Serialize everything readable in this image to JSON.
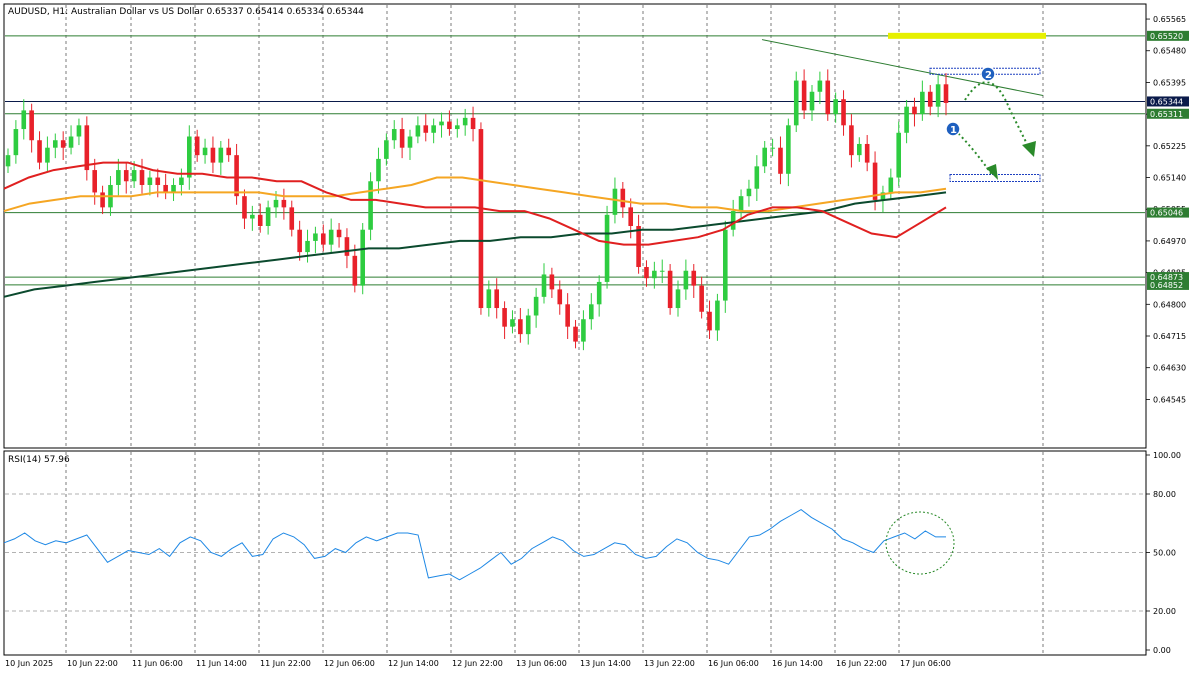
{
  "header": {
    "title": "AUDUSD, H1:  Australian Dollar vs US Dollar  0.65337 0.65414 0.65334 0.65344"
  },
  "rsi": {
    "label": "RSI(14) 57.96",
    "ticks": [
      "100.00",
      "80.00",
      "50.00",
      "20.00",
      "0.00"
    ]
  },
  "price_axis": {
    "ticks": [
      "0.65565",
      "0.65480",
      "0.65395",
      "0.65310",
      "0.65225",
      "0.65140",
      "0.65055",
      "0.64970",
      "0.64885",
      "0.64800",
      "0.64715",
      "0.64630",
      "0.64545"
    ]
  },
  "time_axis": {
    "labels": [
      "10 Jun 2025",
      "10 Jun 22:00",
      "11 Jun 06:00",
      "11 Jun 14:00",
      "11 Jun 22:00",
      "12 Jun 06:00",
      "12 Jun 14:00",
      "12 Jun 22:00",
      "13 Jun 06:00",
      "13 Jun 14:00",
      "13 Jun 22:00",
      "16 Jun 06:00",
      "16 Jun 14:00",
      "16 Jun 22:00",
      "17 Jun 06:00"
    ]
  },
  "price_labels": [
    {
      "text": "0.65520",
      "price": 0.6552,
      "bg": "#2e7d32",
      "fg": "#ffffff"
    },
    {
      "text": "0.65344",
      "price": 0.65344,
      "bg": "#0a1a4a",
      "fg": "#ffffff"
    },
    {
      "text": "0.65311",
      "price": 0.65311,
      "bg": "#2e7d32",
      "fg": "#ffffff"
    },
    {
      "text": "0.65046",
      "price": 0.65046,
      "bg": "#2e7d32",
      "fg": "#ffffff"
    },
    {
      "text": "0.64873",
      "price": 0.64873,
      "bg": "#2e7d32",
      "fg": "#ffffff"
    },
    {
      "text": "0.64852",
      "price": 0.64852,
      "bg": "#2e7d32",
      "fg": "#ffffff"
    }
  ],
  "annotations": {
    "marker1": "1",
    "marker2": "2"
  },
  "colors": {
    "bull": "#2ecc40",
    "bear": "#e8212a",
    "ma_red": "#e02020",
    "ma_orange": "#f5a623",
    "ma_dark": "#0b4a2e",
    "rsi_line": "#1e88e5",
    "hline": "#2e7d32",
    "highlight": "#e6f000"
  },
  "chart_data": {
    "type": "candlestick",
    "symbol": "AUDUSD",
    "timeframe": "H1",
    "ohlc_last": {
      "open": 0.65337,
      "high": 0.65414,
      "low": 0.65334,
      "close": 0.65344
    },
    "ylim": [
      0.6442,
      0.656
    ],
    "closes": [
      0.652,
      0.6527,
      0.6532,
      0.6524,
      0.6518,
      0.6522,
      0.6524,
      0.6522,
      0.6525,
      0.6528,
      0.6516,
      0.651,
      0.6506,
      0.6512,
      0.6516,
      0.6513,
      0.6516,
      0.6512,
      0.6514,
      0.6512,
      0.651,
      0.6512,
      0.6514,
      0.6525,
      0.652,
      0.6522,
      0.6518,
      0.6522,
      0.652,
      0.6509,
      0.6503,
      0.6504,
      0.6501,
      0.6506,
      0.6508,
      0.6506,
      0.65,
      0.6494,
      0.6497,
      0.6499,
      0.6496,
      0.65,
      0.6498,
      0.6493,
      0.6485,
      0.65,
      0.6513,
      0.6519,
      0.6524,
      0.6527,
      0.6522,
      0.6525,
      0.6528,
      0.6526,
      0.6528,
      0.6529,
      0.6527,
      0.6528,
      0.653,
      0.6527,
      0.6479,
      0.6484,
      0.6479,
      0.6474,
      0.6476,
      0.6472,
      0.6477,
      0.6482,
      0.6488,
      0.6484,
      0.648,
      0.6474,
      0.647,
      0.6476,
      0.648,
      0.6486,
      0.6504,
      0.6511,
      0.6506,
      0.6501,
      0.649,
      0.6487,
      0.6489,
      0.6489,
      0.6479,
      0.6484,
      0.6489,
      0.6485,
      0.6478,
      0.6473,
      0.6481,
      0.65,
      0.6505,
      0.6509,
      0.6511,
      0.6517,
      0.6522,
      0.6522,
      0.6515,
      0.6528,
      0.654,
      0.6532,
      0.6537,
      0.654,
      0.6531,
      0.6535,
      0.6528,
      0.652,
      0.6523,
      0.6518,
      0.6508,
      0.651,
      0.6514,
      0.6526,
      0.6533,
      0.6531,
      0.6537,
      0.6533,
      0.6539,
      0.6534
    ],
    "ma_red": [
      0.6511,
      0.6514,
      0.6516,
      0.6517,
      0.6518,
      0.6518,
      0.6516,
      0.6515,
      0.6515,
      0.6514,
      0.6514,
      0.6513,
      0.6513,
      0.651,
      0.6508,
      0.6508,
      0.6507,
      0.6506,
      0.6506,
      0.6506,
      0.6505,
      0.6505,
      0.6503,
      0.65,
      0.6497,
      0.6496,
      0.6496,
      0.6497,
      0.6498,
      0.65,
      0.6504,
      0.6506,
      0.6506,
      0.6505,
      0.6502,
      0.6499,
      0.6498,
      0.6502,
      0.6506
    ],
    "ma_orange": [
      0.6505,
      0.6507,
      0.6508,
      0.6509,
      0.6509,
      0.6509,
      0.651,
      0.651,
      0.651,
      0.651,
      0.651,
      0.6509,
      0.6509,
      0.6509,
      0.651,
      0.6511,
      0.6512,
      0.6514,
      0.6514,
      0.6513,
      0.6512,
      0.6511,
      0.651,
      0.6509,
      0.6508,
      0.6507,
      0.6507,
      0.6506,
      0.6506,
      0.6505,
      0.6505,
      0.6506,
      0.6507,
      0.6508,
      0.6509,
      0.651,
      0.651,
      0.6511
    ],
    "ma_dark": [
      0.6482,
      0.6484,
      0.6485,
      0.6486,
      0.6487,
      0.6488,
      0.6489,
      0.649,
      0.6491,
      0.6492,
      0.6493,
      0.6494,
      0.6495,
      0.6495,
      0.6496,
      0.6497,
      0.6497,
      0.6498,
      0.6498,
      0.6499,
      0.6499,
      0.65,
      0.65,
      0.6501,
      0.6502,
      0.6503,
      0.6504,
      0.6505,
      0.6507,
      0.6508,
      0.6509,
      0.651
    ],
    "rsi_values": [
      55,
      57,
      60,
      56,
      54,
      56,
      55,
      57,
      59,
      52,
      45,
      48,
      51,
      50,
      49,
      52,
      48,
      55,
      58,
      56,
      50,
      48,
      52,
      55,
      48,
      49,
      57,
      60,
      58,
      54,
      47,
      48,
      52,
      50,
      55,
      58,
      56,
      58,
      60,
      60,
      59,
      37,
      38,
      39,
      36,
      39,
      42,
      46,
      50,
      44,
      47,
      52,
      55,
      58,
      56,
      51,
      48,
      49,
      52,
      55,
      54,
      49,
      47,
      48,
      53,
      57,
      55,
      50,
      47,
      46,
      44,
      51,
      58,
      59,
      62,
      66,
      69,
      72,
      68,
      65,
      62,
      57,
      55,
      52,
      50,
      56,
      58,
      60,
      57,
      61,
      58,
      58
    ],
    "rsi_ylim": [
      0,
      100
    ],
    "hlines": [
      0.6552,
      0.65311,
      0.65046,
      0.64873,
      0.64852
    ],
    "current_price": 0.65344
  }
}
